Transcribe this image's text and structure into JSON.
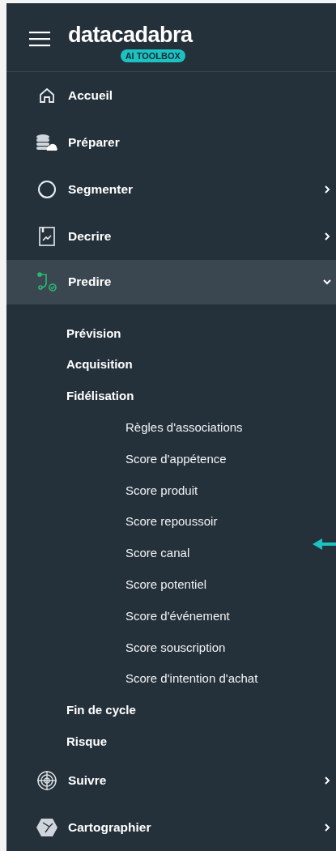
{
  "header": {
    "logo": "datacadabra",
    "badge": "AI TOOLBOX"
  },
  "menu": [
    {
      "label": "Accueil",
      "selected": false
    },
    {
      "label": "Préparer",
      "selected": false
    },
    {
      "label": "Segmenter",
      "selected": false,
      "expanded": false
    },
    {
      "label": "Decrire",
      "selected": false,
      "expanded": false
    },
    {
      "label": "Predire",
      "selected": true,
      "expanded": true,
      "children": [
        {
          "label": "Prévision"
        },
        {
          "label": "Acquisition"
        },
        {
          "label": "Fidélisation",
          "expanded": true,
          "children": [
            {
              "label": "Règles d'associations"
            },
            {
              "label": "Score d'appétence"
            },
            {
              "label": "Score produit"
            },
            {
              "label": "Score repoussoir"
            },
            {
              "label": "Score canal"
            },
            {
              "label": "Score potentiel"
            },
            {
              "label": "Score d'événement"
            },
            {
              "label": "Score souscription"
            },
            {
              "label": "Score d'intention d'achat"
            }
          ]
        },
        {
          "label": "Fin de cycle"
        },
        {
          "label": "Risque"
        }
      ]
    },
    {
      "label": "Suivre",
      "selected": false,
      "expanded": false
    },
    {
      "label": "Cartographier",
      "selected": false,
      "expanded": false
    }
  ]
}
